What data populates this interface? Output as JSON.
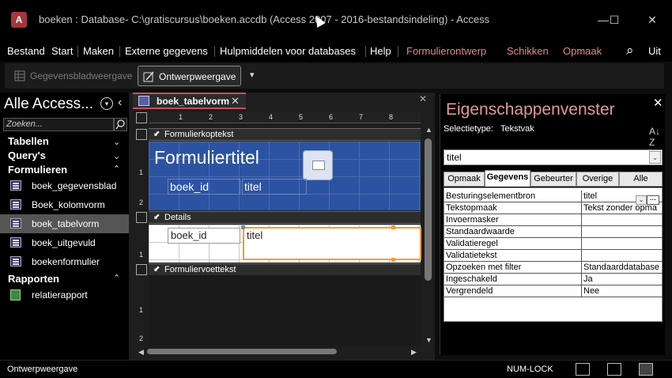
{
  "window": {
    "logo_letter": "A",
    "title": "boeken : Database- C:\\gratiscursus\\boeken.accdb (Access 2007 - 2016-bestandsindeling)  -  Access",
    "minimize": "—",
    "maximize": "☐",
    "close": "✕"
  },
  "menu": {
    "items": [
      "Bestand",
      "Start",
      "Maken",
      "Externe gegevens",
      "Hulpmiddelen voor databases",
      "Help",
      "Formulierontwerp",
      "Schikken",
      "Opmaak"
    ],
    "search_icon": "⌕",
    "overflow": "Uit"
  },
  "ribbon": {
    "datasheet_view": "Gegevensbladweergave",
    "design_view": "Ontwerpweergave",
    "more": "▾"
  },
  "nav": {
    "title": "Alle Access...",
    "search_placeholder": "Zoeken...",
    "groups": {
      "tables": "Tabellen",
      "queries": "Query's",
      "forms": "Formulieren",
      "reports": "Rapporten"
    },
    "forms": [
      "boek_gegevensblad",
      "Boek_kolomvorm",
      "boek_tabelvorm",
      "boek_uitgevuld",
      "boekenformulier"
    ],
    "reports": [
      "relatierapport"
    ],
    "selected_form": "boek_tabelvorm"
  },
  "document": {
    "tab_label": "boek_tabelvorm",
    "ruler_top": [
      "1",
      "2",
      "3",
      "4",
      "5",
      "6",
      "7",
      "8"
    ],
    "ruler_left_header": [
      "1",
      "2"
    ],
    "ruler_left_detail": [
      "1"
    ],
    "ruler_left_footer": [
      "1",
      "2"
    ],
    "sections": {
      "header": "Formulierkoptekst",
      "detail": "Details",
      "footer": "Formuliervoettekst"
    },
    "form_title": "Formuliertitel",
    "header_labels": [
      "boek_id",
      "titel"
    ],
    "detail_fields": [
      "boek_id",
      "titel"
    ]
  },
  "properties": {
    "title": "Eigenschappenvenster",
    "selection_type_label": "Selectietype:",
    "selection_type_value": "Tekstvak",
    "selected_control": "titel",
    "tabs": [
      "Opmaak",
      "Gegevens",
      "Gebeurter",
      "Overige",
      "Alle"
    ],
    "active_tab": "Gegevens",
    "rows": [
      {
        "name": "Besturingselementbron",
        "value": "titel"
      },
      {
        "name": "Tekstopmaak",
        "value": "Tekst zonder opma"
      },
      {
        "name": "Invoermasker",
        "value": ""
      },
      {
        "name": "Standaardwaarde",
        "value": ""
      },
      {
        "name": "Validatieregel",
        "value": ""
      },
      {
        "name": "Validatietekst",
        "value": ""
      },
      {
        "name": "Opzoeken met filter",
        "value": "Standaarddatabase"
      },
      {
        "name": "Ingeschakeld",
        "value": "Ja"
      },
      {
        "name": "Vergrendeld",
        "value": "Nee"
      }
    ]
  },
  "status": {
    "view": "Ontwerpweergave",
    "numlock": "NUM-LOCK"
  },
  "colors": {
    "header_section": "#2c53a2",
    "selection_outline": "#f0a030",
    "property_title": "#e09a9a",
    "tab_accent": "#c5525a"
  }
}
